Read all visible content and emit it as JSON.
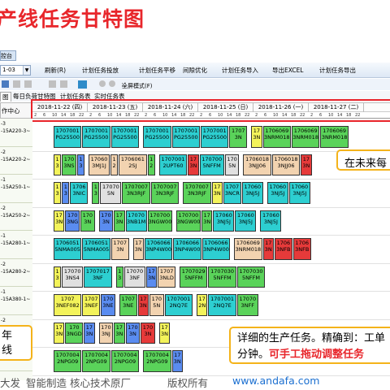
{
  "slide_title": "产线任务甘特图",
  "window_tab": "控台",
  "toolbar": {
    "date_value": "1-03",
    "buttons": [
      {
        "label": "刷新(R)",
        "icon_color": "#3a8a3a"
      },
      {
        "label": "计划任务投放",
        "icon_color": "#5b84c4"
      },
      {
        "label": "计划任务平移",
        "icon_color": "#4a7bc0"
      },
      {
        "label": "间隙优化",
        "icon_color": "#9c6ac2"
      },
      {
        "label": "计划任务导入",
        "icon_color": "#2e8bc9"
      },
      {
        "label": "导出EXCEL",
        "icon_color": "#3a9a4a"
      },
      {
        "label": "计划任务导出",
        "icon_color": "#3a7ac2"
      }
    ]
  },
  "subbar": {
    "text": "全屏模式(F)"
  },
  "tabs": [
    "图",
    "每日负荷甘特图",
    "计划任务表",
    "实时任务表"
  ],
  "header": {
    "left_label": "作中心"
  },
  "days": [
    "2018-11-22 (四)",
    "2018-11-23 (五)",
    "2018-11-24 (六)",
    "2018-11-25 (日)",
    "2018-11-26 (一)",
    "2018-11-27 (二)"
  ],
  "hours": [
    "2",
    "6",
    "10",
    "14",
    "18",
    "22"
  ],
  "rows": [
    {
      "a": "-3",
      "b": "-15A220-3~"
    },
    {
      "a": "-2",
      "b": "-15A220-2~"
    },
    {
      "a": "-1",
      "b": "-15A250-1~"
    },
    {
      "a": "-2",
      "b": "-15A250-2~"
    },
    {
      "a": "-1",
      "b": "-15A280-1~"
    },
    {
      "a": "-2",
      "b": "-15A280-2~"
    },
    {
      "a": "-1",
      "b": "-15A380-1~"
    },
    {
      "a": "-2",
      "b": "-15A380-2~"
    },
    {
      "a": "",
      "b": ""
    }
  ],
  "tasks": [
    [
      {
        "t1": "1707001",
        "t2": "PG25500",
        "color": "#2dcfd1"
      },
      {
        "t1": "1707001",
        "t2": "PG25500",
        "color": "#2dcfd1"
      },
      {
        "t1": "1707001",
        "t2": "PG25500",
        "color": "#2dcfd1"
      },
      {
        "t1": "1707001",
        "t2": "PG25500",
        "color": "#2dcfd1"
      },
      {
        "t1": "1707001",
        "t2": "PG25500",
        "color": "#2dcfd1"
      },
      {
        "t1": "1707001",
        "t2": "PG25500",
        "color": "#2dcfd1"
      },
      {
        "t1": "1707",
        "t2": "3N",
        "color": "#5ad35a"
      },
      {
        "t1": "17",
        "t2": "3N",
        "color": "#f3f35a"
      },
      {
        "t1": "1706069",
        "t2": "3NRM018",
        "color": "#5ad35a"
      },
      {
        "t1": "1706069",
        "t2": "3NRM018",
        "color": "#5ad35a"
      },
      {
        "t1": "1706069",
        "t2": "3NRM018",
        "color": "#5ad35a"
      }
    ],
    [
      {
        "t1": "1",
        "t2": "3",
        "color": "#f3f35a"
      },
      {
        "t1": "170",
        "t2": "3NS",
        "color": "#5ad35a"
      },
      {
        "t1": "1",
        "t2": "3",
        "color": "#5a8cf0"
      },
      {
        "t1": "17060",
        "t2": "3MJ1J",
        "color": "#f2d3b0"
      },
      {
        "t1": "1",
        "t2": "2",
        "color": "#f2d3b0"
      },
      {
        "t1": "1706061",
        "t2": "2SJ",
        "color": "#f2d3b0"
      },
      {
        "t1": "1",
        "t2": "2",
        "color": "#5ad35a"
      },
      {
        "t1": "1707001",
        "t2": "2UPT60",
        "color": "#2dcfd1"
      },
      {
        "t1": "17",
        "t2": "3N",
        "color": "#e63a3a"
      },
      {
        "t1": "170700",
        "t2": "5NFFM",
        "color": "#2dcfd1"
      },
      {
        "t1": "170",
        "t2": "5N",
        "color": "#e0e0e0"
      },
      {
        "t1": "1706018",
        "t2": "3NJJ06",
        "color": "#f2d3b0"
      },
      {
        "t1": "1706018",
        "t2": "3NJJ06",
        "color": "#f2d3b0"
      },
      {
        "t1": "17",
        "t2": "3N",
        "color": "#e63a3a"
      }
    ],
    [
      {
        "t1": "1",
        "t2": "3",
        "color": "#f3f35a"
      },
      {
        "t1": "1",
        "t2": "3",
        "color": "#5a8cf0"
      },
      {
        "t1": "1706",
        "t2": "3NIC",
        "color": "#2dcfd1"
      },
      {
        "t1": "1",
        "t2": "3",
        "color": "#5ad35a"
      },
      {
        "t1": "17070",
        "t2": "5N",
        "color": "#e0e0e0"
      },
      {
        "t1": "1707007",
        "t2": "3N3RJF",
        "color": "#5ad35a"
      },
      {
        "t1": "1707007",
        "t2": "3N3RJF",
        "color": "#5ad35a"
      },
      {
        "t1": "1707007",
        "t2": "3N3RJF",
        "color": "#5ad35a"
      },
      {
        "t1": "17",
        "t2": "3N",
        "color": "#f3f35a"
      },
      {
        "t1": "1707",
        "t2": "3NCR",
        "color": "#2dcfd1"
      },
      {
        "t1": "17060",
        "t2": "3NJ5J",
        "color": "#2dcfd1"
      },
      {
        "t1": "17060",
        "t2": "3NJ5J",
        "color": "#2dcfd1"
      },
      {
        "t1": "17060",
        "t2": "3NJ5J",
        "color": "#2dcfd1"
      }
    ],
    [
      {
        "t1": "17",
        "t2": "3N",
        "color": "#f3f35a"
      },
      {
        "t1": "170",
        "t2": "3NG",
        "color": "#5a8cf0"
      },
      {
        "t1": "170",
        "t2": "3N",
        "color": "#5ad35a"
      },
      {
        "t1": "170",
        "t2": "3N",
        "color": "#5a8cf0"
      },
      {
        "t1": "17",
        "t2": "3N",
        "color": "#5ad35a"
      },
      {
        "t1": "17070",
        "t2": "3NB1M",
        "color": "#2dcfd1"
      },
      {
        "t1": "170700",
        "t2": "3NGW00",
        "color": "#5ad35a"
      },
      {
        "t1": "170700",
        "t2": "3NGW00",
        "color": "#5ad35a"
      },
      {
        "t1": "17",
        "t2": "3N",
        "color": "#5ad35a"
      },
      {
        "t1": "17060",
        "t2": "3NJ5J",
        "color": "#2dcfd1"
      },
      {
        "t1": "17060",
        "t2": "3NJ5J",
        "color": "#2dcfd1"
      },
      {
        "t1": "17060",
        "t2": "3NJ5J",
        "color": "#2dcfd1"
      }
    ],
    [
      {
        "t1": "1706051",
        "t2": "5NMA005",
        "color": "#2dcfd1"
      },
      {
        "t1": "1706051",
        "t2": "5NMA005",
        "color": "#2dcfd1"
      },
      {
        "t1": "1707",
        "t2": "3N",
        "color": "#f2d3b0"
      },
      {
        "t1": "17",
        "t2": "3N",
        "color": "#f2d3b0"
      },
      {
        "t1": "1706066",
        "t2": "3NP4W00",
        "color": "#2dcfd1"
      },
      {
        "t1": "1706066",
        "t2": "3NP4W00",
        "color": "#2dcfd1"
      },
      {
        "t1": "1706066",
        "t2": "3NP4W00",
        "color": "#2dcfd1"
      },
      {
        "t1": "1706069",
        "t2": "3NRM018",
        "color": "#f2d3b0"
      },
      {
        "t1": "17",
        "t2": "3N",
        "color": "#e63a3a"
      },
      {
        "t1": "1706",
        "t2": "3NFB",
        "color": "#e63a3a"
      },
      {
        "t1": "1706",
        "t2": "3NFB",
        "color": "#e63a3a"
      }
    ],
    [
      {
        "t1": "1",
        "t2": "3",
        "color": "#f3f35a"
      },
      {
        "t1": "17070",
        "t2": "3NS4",
        "color": "#e0e0e0"
      },
      {
        "t1": "1707017",
        "t2": "3NF",
        "color": "#2dcfd1"
      },
      {
        "t1": "1",
        "t2": "3",
        "color": "#5ad35a"
      },
      {
        "t1": "17070",
        "t2": "3NF",
        "color": "#e0e0e0"
      },
      {
        "t1": "17",
        "t2": "3N",
        "color": "#5a8cf0"
      },
      {
        "t1": "1707",
        "t2": "3NLD",
        "color": "#f2d3b0"
      },
      {
        "t1": "1707029",
        "t2": "5NFFM",
        "color": "#5ad35a"
      },
      {
        "t1": "1707030",
        "t2": "5NFFM",
        "color": "#5ad35a"
      },
      {
        "t1": "1707030",
        "t2": "5NFFM",
        "color": "#5ad35a"
      }
    ],
    [
      {
        "t1": "1707",
        "t2": "3NEF082",
        "color": "#f3f35a"
      },
      {
        "t1": "1707",
        "t2": "3NEF",
        "color": "#f3f35a"
      },
      {
        "t1": "170",
        "t2": "3NE",
        "color": "#5a8cf0"
      },
      {
        "t1": "1707",
        "t2": "3NE",
        "color": "#5ad35a"
      },
      {
        "t1": "17",
        "t2": "3N",
        "color": "#e63a3a"
      },
      {
        "t1": "170",
        "t2": "5N",
        "color": "#f2d3b0"
      },
      {
        "t1": "1707001",
        "t2": "2NQ7E",
        "color": "#2dcfd1"
      },
      {
        "t1": "17",
        "t2": "2N",
        "color": "#f3f35a"
      },
      {
        "t1": "1707001",
        "t2": "2NQ7E",
        "color": "#2dcfd1"
      },
      {
        "t1": "17070",
        "t2": "3NFF",
        "color": "#5ad35a"
      }
    ],
    [
      {
        "t1": "17",
        "t2": "3N",
        "color": "#f3f35a"
      },
      {
        "t1": "170",
        "t2": "3NGD",
        "color": "#5ad35a"
      },
      {
        "t1": "17",
        "t2": "3N",
        "color": "#5a8cf0"
      },
      {
        "t1": "170",
        "t2": "3NJ",
        "color": "#f2d3b0"
      },
      {
        "t1": "17",
        "t2": "3N",
        "color": "#5ad35a"
      },
      {
        "t1": "170",
        "t2": "3N",
        "color": "#5a8cf0"
      },
      {
        "t1": "170",
        "t2": "3N",
        "color": "#e63a3a"
      },
      {
        "t1": "17",
        "t2": "3N",
        "color": "#f3f35a"
      }
    ],
    [
      {
        "t1": "1707004",
        "t2": "2NPG09",
        "color": "#5ad35a"
      },
      {
        "t1": "1707004",
        "t2": "2NPG09",
        "color": "#5ad35a"
      },
      {
        "t1": "1707004",
        "t2": "2NPG09",
        "color": "#5ad35a"
      },
      {
        "t1": "1707004",
        "t2": "2NPG09",
        "color": "#5ad35a"
      },
      {
        "t1": "17",
        "t2": "3N",
        "color": "#5a8cf0"
      }
    ]
  ],
  "callouts": {
    "future_line1": "在未来每",
    "detail_line1": "详细的生产任务。精确到：工单",
    "detail_line2_black": "分钟。",
    "detail_line2_red": "可手工拖动调整任务",
    "left_line1": "年",
    "left_line2": "线"
  },
  "footer": {
    "company": "大发",
    "slogan": "智能制造  核心技术原厂",
    "rights": "版权所有",
    "url": "www.andafa.com"
  },
  "colors": {
    "title_red": "#e8262b",
    "highlight_border": "#e9252b",
    "callout_border": "#f4b31a",
    "link_blue": "#1b6fd0"
  }
}
